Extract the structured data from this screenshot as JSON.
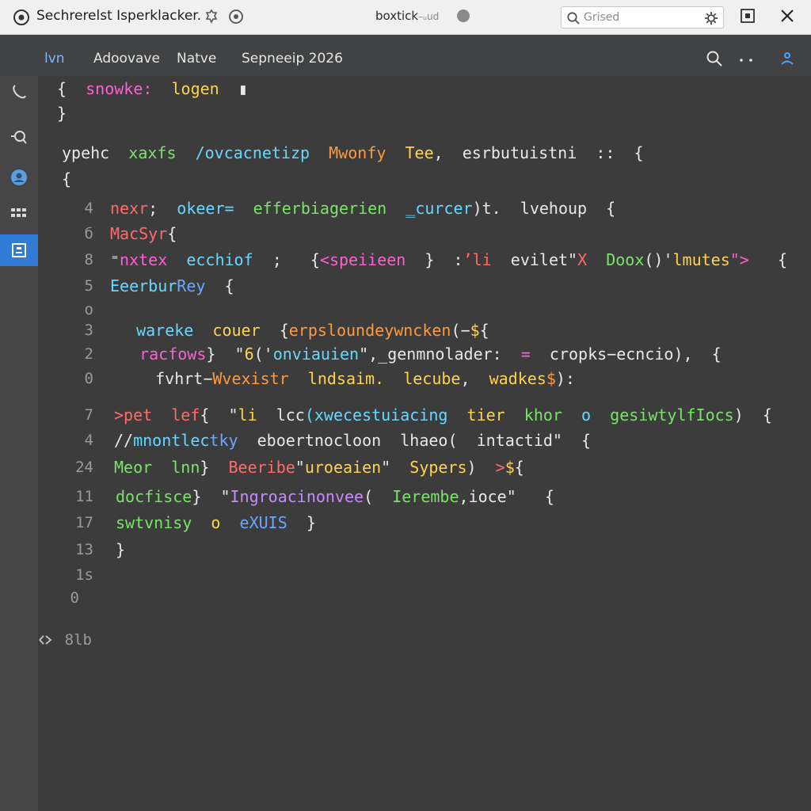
{
  "titlebar": {
    "title": "Sechrerelst Isperklacker.",
    "center_main": "boxtick",
    "center_suffix": "–ᵤud",
    "search_placeholder": "Grised"
  },
  "toolbar": {
    "tabs": [
      "lvn",
      "Adoovave",
      "Natve",
      "Sepneeip 2026"
    ],
    "active_tab": 0,
    "accent": "#7fb4ff"
  },
  "activity": {
    "items": [
      "phone-icon",
      "search-icon",
      "account-icon",
      "grid-icon",
      "panel-icon"
    ],
    "selected": 4
  },
  "editor": {
    "lines": [
      {
        "n": "",
        "parts": [
          [
            "w",
            "{  "
          ],
          [
            "m",
            "snowke:  "
          ],
          [
            "y",
            "logen  "
          ],
          [
            "w",
            "▮"
          ]
        ]
      },
      {
        "n": "",
        "parts": [
          [
            "w",
            "}"
          ]
        ]
      },
      {
        "n": "",
        "parts": [
          [
            "w",
            "ypehc  "
          ],
          [
            "g",
            "xaxfs  "
          ],
          [
            "c",
            "/ovcacnetizp  "
          ],
          [
            "o",
            "Mwonfy  "
          ],
          [
            "y",
            "Tee"
          ],
          [
            "w",
            ",  esrbutuistni  ::  {"
          ]
        ]
      },
      {
        "n": "",
        "parts": [
          [
            "w",
            "{"
          ]
        ]
      },
      {
        "n": "4",
        "parts": [
          [
            "r",
            "nexr"
          ],
          [
            "w",
            ";  "
          ],
          [
            "c",
            "okeer="
          ],
          [
            "w",
            "  "
          ],
          [
            "g",
            "efferbiagerien  "
          ],
          [
            "c",
            "‗curcer"
          ],
          [
            "w",
            ")t.  lvehoup  {"
          ]
        ]
      },
      {
        "n": "б",
        "parts": [
          [
            "r",
            "MacSyr"
          ],
          [
            "w",
            "{"
          ]
        ]
      },
      {
        "n": "8",
        "parts": [
          [
            "w",
            "⁼"
          ],
          [
            "m",
            "nxtex  "
          ],
          [
            "c",
            "ecchiof"
          ],
          [
            "w",
            "  ;   {"
          ],
          [
            "m",
            "<speiieen"
          ],
          [
            "w",
            "  }  :"
          ],
          [
            "r",
            "ʼli  "
          ],
          [
            "w",
            "evilet\""
          ],
          [
            "r",
            "X  "
          ],
          [
            "g",
            "Doox"
          ],
          [
            "w",
            "()'"
          ],
          [
            "y",
            "lmutes"
          ],
          [
            "m",
            "\"> "
          ],
          [
            "w",
            "  {"
          ]
        ]
      },
      {
        "n": "5",
        "parts": [
          [
            "c",
            "Eeerbur"
          ],
          [
            "b",
            "Rey"
          ],
          [
            "w",
            "  {"
          ]
        ]
      },
      {
        "n": "o",
        "parts": []
      },
      {
        "n": "3",
        "parts": [
          [
            "w",
            "  "
          ],
          [
            "c",
            "wareke  "
          ],
          [
            "y",
            "couer"
          ],
          [
            "w",
            "  {"
          ],
          [
            "o",
            "erpsloundeywncken"
          ],
          [
            "w",
            "(−"
          ],
          [
            "y",
            "$"
          ],
          [
            "w",
            "{"
          ]
        ]
      },
      {
        "n": "2",
        "parts": [
          [
            "w",
            "  "
          ],
          [
            "m",
            "racfows"
          ],
          [
            "w",
            "}  \""
          ],
          [
            "y",
            "6"
          ],
          [
            "w",
            "('"
          ],
          [
            "c",
            "onviauien"
          ],
          [
            "w",
            "\",_genmnolader:  "
          ],
          [
            "m",
            "="
          ],
          [
            "w",
            "  cropks−ecncio),  {"
          ]
        ]
      },
      {
        "n": "0",
        "parts": [
          [
            "w",
            "   fvhrt−"
          ],
          [
            "o",
            "Wvexistr  "
          ],
          [
            "y",
            "lndsaim."
          ],
          [
            "w",
            "  "
          ],
          [
            "y",
            "lecube"
          ],
          [
            "w",
            ",  "
          ],
          [
            "y",
            "wadkes"
          ],
          [
            "o",
            "$"
          ],
          [
            "w",
            "):"
          ]
        ]
      },
      {
        "n": "7",
        "parts": [
          [
            "r",
            ">pet  lef"
          ],
          [
            "w",
            "{  \""
          ],
          [
            "y",
            "li  "
          ],
          [
            "w",
            "lcc"
          ],
          [
            "c",
            "(xwecestuiacing  "
          ],
          [
            "y",
            "tier  "
          ],
          [
            "g",
            "khor  "
          ],
          [
            "c",
            "o  "
          ],
          [
            "g",
            "gesiwtylfIocs"
          ],
          [
            "w",
            ")  {"
          ]
        ]
      },
      {
        "n": "4",
        "parts": [
          [
            "w",
            "//"
          ],
          [
            "c",
            "mnontlec"
          ],
          [
            "b",
            "tky  "
          ],
          [
            "w",
            "eboertnocloon  lhaeo(  intactid\"  {"
          ]
        ]
      },
      {
        "n": "24",
        "parts": [
          [
            "g",
            "Meor  lnn"
          ],
          [
            "w",
            "}  "
          ],
          [
            "r",
            "Beeribe"
          ],
          [
            "w",
            "\""
          ],
          [
            "y",
            "uroeaien"
          ],
          [
            "w",
            "\"  "
          ],
          [
            "y",
            "Sypers"
          ],
          [
            "w",
            ")  "
          ],
          [
            "r",
            ">"
          ],
          [
            "y",
            "$"
          ],
          [
            "w",
            "{"
          ]
        ]
      },
      {
        "n": "11",
        "parts": [
          [
            "g",
            "docfisce"
          ],
          [
            "w",
            "}  \""
          ],
          [
            "p",
            "Ingroacinonvee"
          ],
          [
            "w",
            "(  "
          ],
          [
            "g",
            "Ierembe"
          ],
          [
            "w",
            ",ioce\"   {"
          ]
        ]
      },
      {
        "n": "17",
        "parts": [
          [
            "g",
            "swtvnisy  "
          ],
          [
            "y",
            "o  "
          ],
          [
            "b",
            "eXUIS"
          ],
          [
            "w",
            "  }"
          ]
        ]
      },
      {
        "n": "13",
        "parts": [
          [
            "w",
            "}"
          ]
        ]
      },
      {
        "n": "1s",
        "parts": []
      },
      {
        "n": "0",
        "parts": []
      },
      {
        "n": "8lb",
        "parts": []
      }
    ]
  }
}
